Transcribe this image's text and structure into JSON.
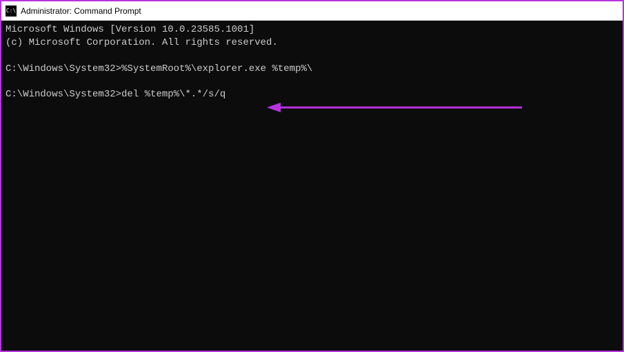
{
  "titlebar": {
    "icon_label": "C:\\",
    "title": "Administrator: Command Prompt"
  },
  "terminal": {
    "header_line1": "Microsoft Windows [Version 10.0.23585.1001]",
    "header_line2": "(c) Microsoft Corporation. All rights reserved.",
    "lines": [
      {
        "prompt": "C:\\Windows\\System32>",
        "command": "%SystemRoot%\\explorer.exe %temp%\\"
      },
      {
        "prompt": "C:\\Windows\\System32>",
        "command": "del %temp%\\*.*/s/q"
      }
    ]
  },
  "annotation": {
    "arrow_color": "#b833e0"
  }
}
